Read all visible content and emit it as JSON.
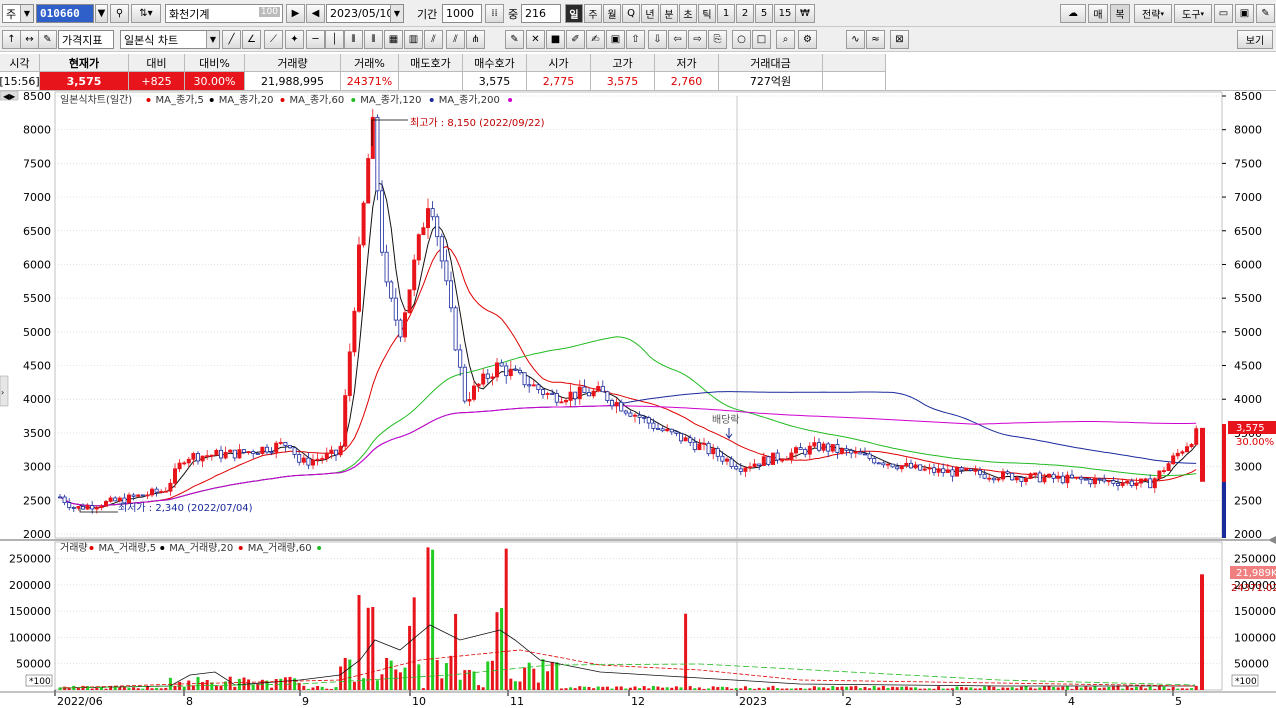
{
  "toolbar1": {
    "type_label": "주",
    "code": "010660",
    "name": "화천기계",
    "name_badge": "100",
    "date": "2023/05/10",
    "period_label": "기간",
    "period_value": "1000",
    "mid_label": "중",
    "mid_value": "216",
    "timeframes": [
      "일",
      "주",
      "월",
      "Q",
      "년",
      "분",
      "초",
      "틱",
      "1",
      "2",
      "5",
      "15"
    ],
    "selected_timeframe": "일",
    "won_symbol": "₩",
    "right_buttons": [
      "매",
      "복",
      "전략",
      "도구"
    ]
  },
  "toolbar2": {
    "price_indicator": "가격지표",
    "chart_type": "일본식 차트",
    "view_label": "보기"
  },
  "quote": {
    "headers": [
      "시각",
      "현재가",
      "대비",
      "대비%",
      "거래량",
      "거래%",
      "매도호가",
      "매수호가",
      "시가",
      "고가",
      "저가",
      "거래대금"
    ],
    "time": "[15:56]",
    "current": "3,575",
    "change": "+825",
    "change_pct": "30.00%",
    "volume": "21,988,995",
    "volume_pct": "24371%",
    "ask": "",
    "bid": "3,575",
    "open": "2,775",
    "high": "3,575",
    "low": "2,760",
    "amount": "727억원"
  },
  "chart": {
    "legend_parts": [
      "일본식차트(일간)",
      "MA_종가,5",
      "MA_종가,20",
      "MA_종가,60",
      "MA_종가,120",
      "MA_종가,200"
    ],
    "legend_colors": [
      "#e00000",
      "#e00000",
      "#000000",
      "#e00000",
      "#22bb22",
      "#1a2a9c",
      "#d000d0"
    ],
    "annot_high": "최고가 : 8,150 (2022/09/22)",
    "annot_low": "최저가 : 2,340 (2022/07/04)",
    "annot_mid": "배당락",
    "last_price_label": "3,575",
    "last_pct_label": "30.00%",
    "price_ticks": [
      "8500",
      "8000",
      "7500",
      "7000",
      "6500",
      "6000",
      "5500",
      "5000",
      "4500",
      "4000",
      "3500",
      "3000",
      "2500",
      "2000"
    ],
    "vol_legend_parts": [
      "거래량",
      "MA_거래량,5",
      "MA_거래량,20",
      "MA_거래량,60"
    ],
    "vol_legend_colors": [
      "#e00000",
      "#000000",
      "#e00000",
      "#22bb22"
    ],
    "vol_ticks": [
      "250000",
      "200000",
      "150000",
      "100000",
      "50000"
    ],
    "vol_unit": "*100",
    "vol_last_label": "21,989K",
    "vol_pct_label": "24371.02",
    "x_labels": [
      "2022/06",
      "8",
      "9",
      "10",
      "11",
      "12",
      "2023",
      "2",
      "3",
      "4",
      "5"
    ]
  },
  "chart_data": {
    "type": "candlestick",
    "title": "일본식차트(일간)",
    "y_range": [
      2000,
      8500
    ],
    "volume_range_x100": [
      0,
      270000
    ],
    "close_series": [
      [
        "2022/06",
        2550
      ],
      [
        "2022/07 early",
        2380
      ],
      [
        "2022/07 mid",
        2500
      ],
      [
        "2022/07 end",
        2650
      ],
      [
        "2022/08 early",
        3150
      ],
      [
        "2022/08 mid",
        3200
      ],
      [
        "2022/08 end",
        3350
      ],
      [
        "2022/09 early",
        3050
      ],
      [
        "2022/09 mid",
        3200
      ],
      [
        "2022/09/22 high",
        8150
      ],
      [
        "2022/09 end",
        5700
      ],
      [
        "2022/10 early",
        5000
      ],
      [
        "2022/10 mid",
        7100
      ],
      [
        "2022/10 end",
        4000
      ],
      [
        "2022/11 early",
        4500
      ],
      [
        "2022/11 mid",
        4050
      ],
      [
        "2022/12 early",
        4100
      ],
      [
        "2022/12 mid",
        3550
      ],
      [
        "2022/12 end",
        3300
      ],
      [
        "2023/01",
        3000
      ],
      [
        "2023/02",
        3300
      ],
      [
        "2023/03",
        2950
      ],
      [
        "2023/04",
        2850
      ],
      [
        "2023/05 early",
        2750
      ],
      [
        "2023/05/10",
        3575
      ]
    ],
    "annotations": {
      "high": 8150,
      "high_date": "2022/09/22",
      "low": 2340,
      "low_date": "2022/07/04"
    },
    "last_volume": "21,989K"
  }
}
